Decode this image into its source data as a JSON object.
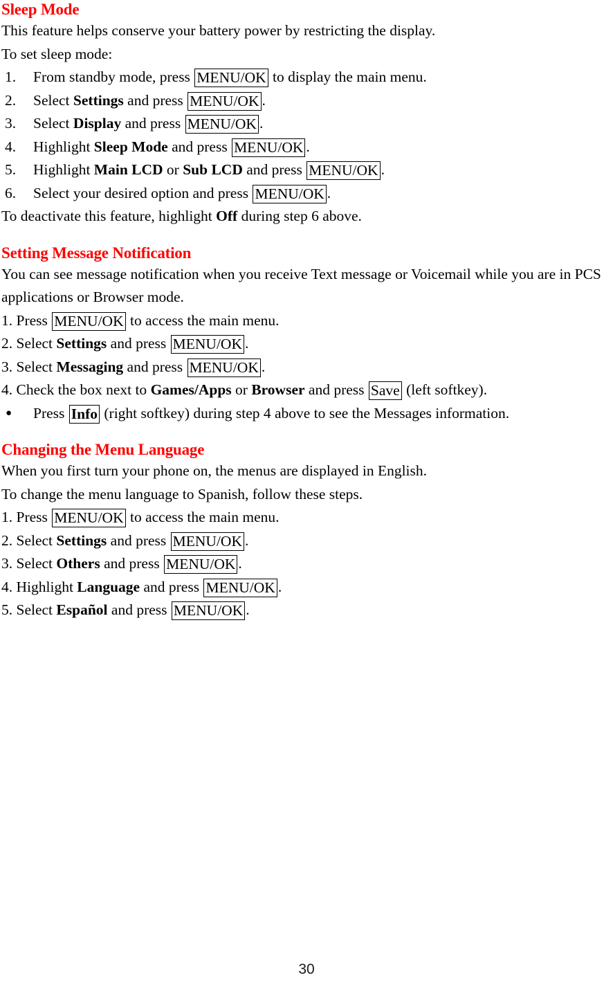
{
  "document": {
    "page_number": "30",
    "heading_color": "#ff0000",
    "text_color": "#000000"
  },
  "sections": [
    {
      "heading": "Sleep Mode",
      "intro_lines": [
        "This feature helps conserve your battery power by restricting the display.",
        "To set sleep mode:"
      ],
      "steps": [
        {
          "marker": "1.",
          "parts": [
            {
              "type": "text",
              "text": "From standby mode, press "
            },
            {
              "type": "key",
              "text": "MENU/OK"
            },
            {
              "type": "text",
              "text": " to display the main menu."
            }
          ]
        },
        {
          "marker": "2.",
          "parts": [
            {
              "type": "text",
              "text": "Select "
            },
            {
              "type": "bold",
              "text": "Settings"
            },
            {
              "type": "text",
              "text": " and press "
            },
            {
              "type": "key",
              "text": "MENU/OK"
            },
            {
              "type": "text",
              "text": "."
            }
          ]
        },
        {
          "marker": "3.",
          "parts": [
            {
              "type": "text",
              "text": "Select "
            },
            {
              "type": "bold",
              "text": "Display"
            },
            {
              "type": "text",
              "text": " and press "
            },
            {
              "type": "key",
              "text": "MENU/OK"
            },
            {
              "type": "text",
              "text": "."
            }
          ]
        },
        {
          "marker": "4.",
          "parts": [
            {
              "type": "text",
              "text": "Highlight "
            },
            {
              "type": "bold",
              "text": "Sleep Mode"
            },
            {
              "type": "text",
              "text": " and press "
            },
            {
              "type": "key",
              "text": "MENU/OK"
            },
            {
              "type": "text",
              "text": "."
            }
          ]
        },
        {
          "marker": "5.",
          "parts": [
            {
              "type": "text",
              "text": "Highlight "
            },
            {
              "type": "bold",
              "text": "Main LCD"
            },
            {
              "type": "text",
              "text": " or "
            },
            {
              "type": "bold",
              "text": "Sub LCD"
            },
            {
              "type": "text",
              "text": " and press "
            },
            {
              "type": "key",
              "text": "MENU/OK"
            },
            {
              "type": "text",
              "text": "."
            }
          ]
        },
        {
          "marker": "6.",
          "parts": [
            {
              "type": "text",
              "text": "Select your desired option and press "
            },
            {
              "type": "key",
              "text": "MENU/OK"
            },
            {
              "type": "text",
              "text": "."
            }
          ]
        }
      ],
      "outro": {
        "parts": [
          {
            "type": "text",
            "text": "To deactivate this feature, highlight "
          },
          {
            "type": "bold",
            "text": "Off"
          },
          {
            "type": "text",
            "text": " during step 6 above."
          }
        ]
      }
    },
    {
      "heading": "Setting Message Notification",
      "intro_paragraph": "You can see message notification when you receive Text message or Voicemail while you are in PCS applications or Browser mode.",
      "steps": [
        {
          "parts": [
            {
              "type": "text",
              "text": "1. Press "
            },
            {
              "type": "key",
              "text": "MENU/OK"
            },
            {
              "type": "text",
              "text": " to access the main menu."
            }
          ]
        },
        {
          "parts": [
            {
              "type": "text",
              "text": "2. Select "
            },
            {
              "type": "bold",
              "text": "Settings"
            },
            {
              "type": "text",
              "text": " and press "
            },
            {
              "type": "key",
              "text": "MENU/OK"
            },
            {
              "type": "text",
              "text": "."
            }
          ]
        },
        {
          "parts": [
            {
              "type": "text",
              "text": "3. Select "
            },
            {
              "type": "bold",
              "text": "Messaging"
            },
            {
              "type": "text",
              "text": " and press "
            },
            {
              "type": "key",
              "text": "MENU/OK"
            },
            {
              "type": "text",
              "text": "."
            }
          ]
        },
        {
          "parts": [
            {
              "type": "text",
              "text": "4. Check the box next to "
            },
            {
              "type": "bold",
              "text": "Games/Apps"
            },
            {
              "type": "text",
              "text": " or "
            },
            {
              "type": "bold",
              "text": "Browser"
            },
            {
              "type": "text",
              "text": " and press "
            },
            {
              "type": "key",
              "text": "Save"
            },
            {
              "type": "text",
              "text": " (left softkey)."
            }
          ]
        }
      ],
      "bullets": [
        {
          "glyph": "●",
          "parts": [
            {
              "type": "text",
              "text": "Press "
            },
            {
              "type": "key-bold",
              "text": "Info"
            },
            {
              "type": "text",
              "text": " (right softkey) during step 4 above to see the Messages information."
            }
          ]
        }
      ]
    },
    {
      "heading": "Changing the Menu Language",
      "intro_lines": [
        "When you first turn your phone on, the menus are displayed in English.",
        "To change the menu language to Spanish, follow these steps."
      ],
      "steps": [
        {
          "parts": [
            {
              "type": "text",
              "text": "1. Press "
            },
            {
              "type": "key",
              "text": "MENU/OK"
            },
            {
              "type": "text",
              "text": " to access the main menu."
            }
          ]
        },
        {
          "parts": [
            {
              "type": "text",
              "text": "2. Select "
            },
            {
              "type": "bold",
              "text": "Settings"
            },
            {
              "type": "text",
              "text": " and press "
            },
            {
              "type": "key",
              "text": "MENU/OK"
            },
            {
              "type": "text",
              "text": "."
            }
          ]
        },
        {
          "parts": [
            {
              "type": "text",
              "text": "3. Select "
            },
            {
              "type": "bold",
              "text": "Others"
            },
            {
              "type": "text",
              "text": " and press "
            },
            {
              "type": "key",
              "text": "MENU/OK"
            },
            {
              "type": "text",
              "text": "."
            }
          ]
        },
        {
          "parts": [
            {
              "type": "text",
              "text": "4. Highlight "
            },
            {
              "type": "bold",
              "text": "Language"
            },
            {
              "type": "text",
              "text": " and press "
            },
            {
              "type": "key",
              "text": "MENU/OK"
            },
            {
              "type": "text",
              "text": "."
            }
          ]
        },
        {
          "parts": [
            {
              "type": "text",
              "text": "5. Select "
            },
            {
              "type": "bold",
              "text": "Español"
            },
            {
              "type": "text",
              "text": " and press "
            },
            {
              "type": "key",
              "text": "MENU/OK"
            },
            {
              "type": "text",
              "text": "."
            }
          ]
        }
      ]
    }
  ]
}
